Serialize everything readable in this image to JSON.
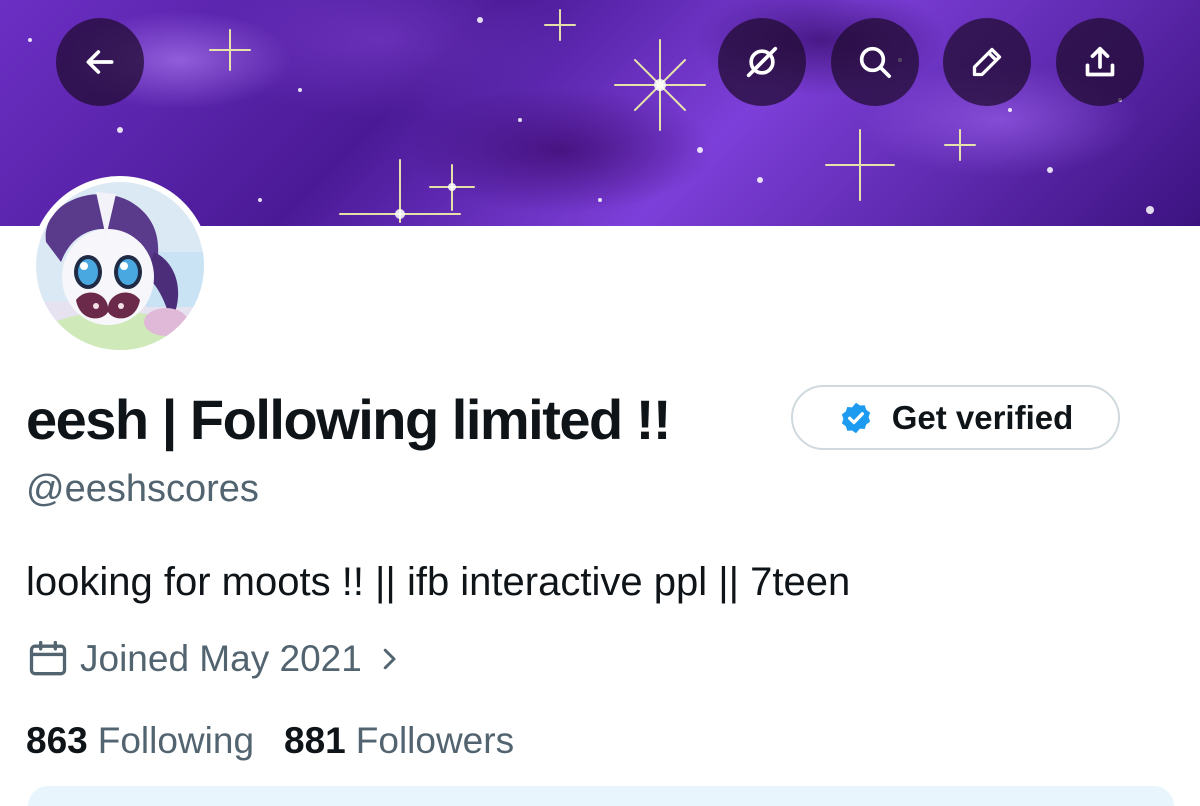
{
  "banner": {
    "description_colors": {
      "base": "#6c2fc4",
      "star": "#f3f6a8"
    }
  },
  "top_bar": {
    "back_icon": "arrow-left-icon",
    "actions": [
      {
        "name": "mute-icon"
      },
      {
        "name": "search-icon"
      },
      {
        "name": "edit-icon"
      },
      {
        "name": "share-icon"
      }
    ]
  },
  "profile": {
    "display_name": "eesh | Following limited !!",
    "handle": "@eeshscores",
    "bio": "looking for moots !! || ifb interactive ppl || 7teen",
    "joined": "Joined May 2021",
    "verify_button": "Get verified",
    "verified_badge_color": "#1d9bf0"
  },
  "stats": {
    "following_count": "863",
    "following_label": "Following",
    "followers_count": "881",
    "followers_label": "Followers"
  },
  "colors": {
    "primary_text": "#0f1419",
    "secondary_text": "#536471",
    "border": "#cfd9de"
  }
}
